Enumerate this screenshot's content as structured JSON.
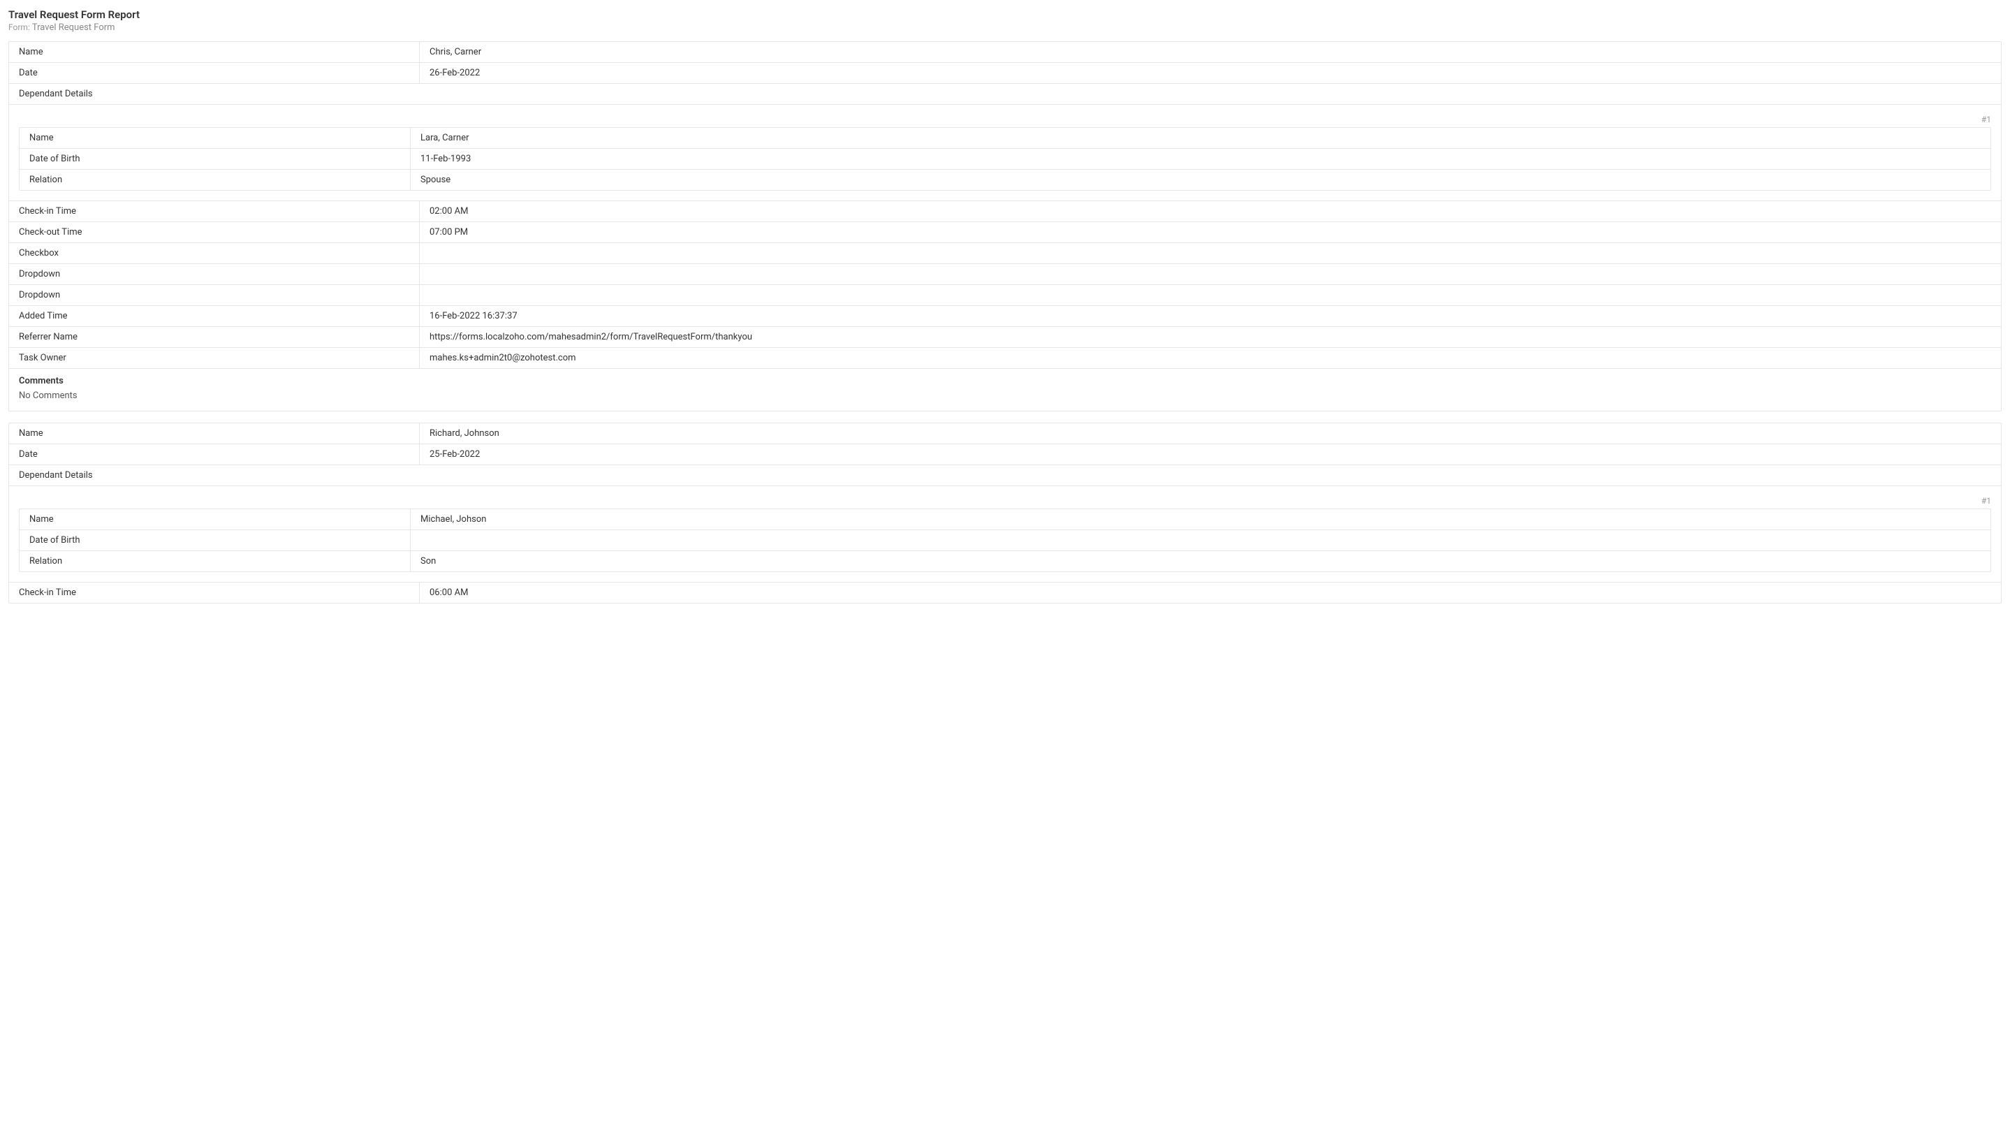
{
  "header": {
    "title": "Travel Request Form Report",
    "form_label": "Form: ",
    "form_name": "Travel Request Form"
  },
  "labels": {
    "name": "Name",
    "date": "Date",
    "dependant_details": "Dependant Details",
    "dob": "Date of Birth",
    "relation": "Relation",
    "checkin": "Check-in Time",
    "checkout": "Check-out Time",
    "checkbox": "Checkbox",
    "dropdown": "Dropdown",
    "added_time": "Added Time",
    "referrer": "Referrer Name",
    "task_owner": "Task Owner",
    "comments": "Comments",
    "sub_index_1": "#1"
  },
  "records": [
    {
      "name": "Chris, Carner",
      "date": "26-Feb-2022",
      "dependants": [
        {
          "name": "Lara, Carner",
          "dob": "11-Feb-1993",
          "relation": "Spouse"
        }
      ],
      "checkin": "02:00 AM",
      "checkout": "07:00 PM",
      "checkbox": "",
      "dropdown1": "",
      "dropdown2": "",
      "added_time": "16-Feb-2022 16:37:37",
      "referrer": "https://forms.localzoho.com/mahesadmin2/form/TravelRequestForm/thankyou",
      "task_owner": "mahes.ks+admin2t0@zohotest.com",
      "comments": "No Comments"
    },
    {
      "name": "Richard, Johnson",
      "date": "25-Feb-2022",
      "dependants": [
        {
          "name": "Michael, Johson",
          "dob": "",
          "relation": "Son"
        }
      ],
      "checkin": "06:00 AM"
    }
  ]
}
